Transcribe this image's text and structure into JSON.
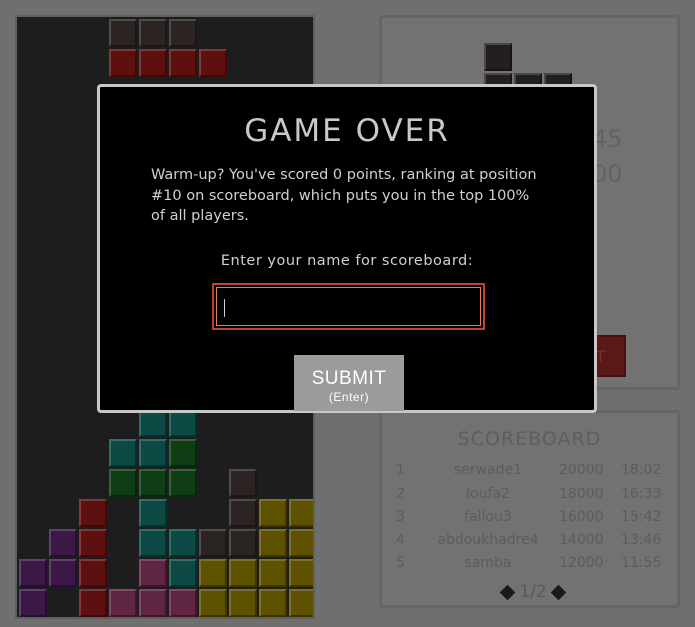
{
  "board": {
    "colors": {
      "dark": "#2c2323",
      "red": "#5e1010",
      "teal": "#0d4a45",
      "green": "#0f3d14",
      "purple": "#3c1848",
      "pink": "#602542",
      "yellow": "#5e5200"
    },
    "cells": [
      {
        "c": 3,
        "r": 0,
        "k": "dark"
      },
      {
        "c": 4,
        "r": 0,
        "k": "dark"
      },
      {
        "c": 5,
        "r": 0,
        "k": "dark"
      },
      {
        "c": 3,
        "r": 1,
        "k": "red"
      },
      {
        "c": 4,
        "r": 1,
        "k": "red"
      },
      {
        "c": 5,
        "r": 1,
        "k": "red"
      },
      {
        "c": 6,
        "r": 1,
        "k": "red"
      },
      {
        "c": 4,
        "r": 13,
        "k": "teal"
      },
      {
        "c": 5,
        "r": 13,
        "k": "teal"
      },
      {
        "c": 3,
        "r": 14,
        "k": "teal"
      },
      {
        "c": 4,
        "r": 14,
        "k": "teal"
      },
      {
        "c": 5,
        "r": 14,
        "k": "green"
      },
      {
        "c": 3,
        "r": 15,
        "k": "green"
      },
      {
        "c": 4,
        "r": 15,
        "k": "green"
      },
      {
        "c": 5,
        "r": 15,
        "k": "green"
      },
      {
        "c": 7,
        "r": 15,
        "k": "dark"
      },
      {
        "c": 2,
        "r": 16,
        "k": "red"
      },
      {
        "c": 4,
        "r": 16,
        "k": "teal"
      },
      {
        "c": 7,
        "r": 16,
        "k": "dark"
      },
      {
        "c": 8,
        "r": 16,
        "k": "yellow"
      },
      {
        "c": 9,
        "r": 16,
        "k": "yellow"
      },
      {
        "c": 1,
        "r": 17,
        "k": "purple"
      },
      {
        "c": 2,
        "r": 17,
        "k": "red"
      },
      {
        "c": 4,
        "r": 17,
        "k": "teal"
      },
      {
        "c": 5,
        "r": 17,
        "k": "teal"
      },
      {
        "c": 6,
        "r": 17,
        "k": "dark"
      },
      {
        "c": 7,
        "r": 17,
        "k": "dark"
      },
      {
        "c": 8,
        "r": 17,
        "k": "yellow"
      },
      {
        "c": 9,
        "r": 17,
        "k": "yellow"
      },
      {
        "c": 0,
        "r": 18,
        "k": "purple"
      },
      {
        "c": 1,
        "r": 18,
        "k": "purple"
      },
      {
        "c": 2,
        "r": 18,
        "k": "red"
      },
      {
        "c": 4,
        "r": 18,
        "k": "pink"
      },
      {
        "c": 5,
        "r": 18,
        "k": "teal"
      },
      {
        "c": 6,
        "r": 18,
        "k": "yellow"
      },
      {
        "c": 7,
        "r": 18,
        "k": "yellow"
      },
      {
        "c": 8,
        "r": 18,
        "k": "yellow"
      },
      {
        "c": 9,
        "r": 18,
        "k": "yellow"
      },
      {
        "c": 0,
        "r": 19,
        "k": "purple"
      },
      {
        "c": 2,
        "r": 19,
        "k": "red"
      },
      {
        "c": 3,
        "r": 19,
        "k": "pink"
      },
      {
        "c": 4,
        "r": 19,
        "k": "pink"
      },
      {
        "c": 5,
        "r": 19,
        "k": "pink"
      },
      {
        "c": 6,
        "r": 19,
        "k": "yellow"
      },
      {
        "c": 7,
        "r": 19,
        "k": "yellow"
      },
      {
        "c": 8,
        "r": 19,
        "k": "yellow"
      },
      {
        "c": 9,
        "r": 19,
        "k": "yellow"
      }
    ]
  },
  "next_piece": {
    "color": "#241e1e",
    "cells": [
      {
        "c": 0,
        "r": 0
      },
      {
        "c": 0,
        "r": 1
      },
      {
        "c": 1,
        "r": 1
      },
      {
        "c": 2,
        "r": 1
      }
    ]
  },
  "stats": {
    "lines_value": "45",
    "score_value": "00"
  },
  "restart_label": "RT",
  "scoreboard": {
    "title": "SCOREBOARD",
    "rows": [
      {
        "rank": "1",
        "name": "serwade1",
        "score": "20000",
        "time": "18:02"
      },
      {
        "rank": "2",
        "name": "loufa2",
        "score": "18000",
        "time": "16:33"
      },
      {
        "rank": "3",
        "name": "fallou3",
        "score": "16000",
        "time": "15:42"
      },
      {
        "rank": "4",
        "name": "abdoukhadre4",
        "score": "14000",
        "time": "13:46"
      },
      {
        "rank": "5",
        "name": "samba",
        "score": "12000",
        "time": "11:55"
      }
    ],
    "page_label": "1/2"
  },
  "modal": {
    "title": "GAME OVER",
    "message": "Warm-up? You've scored 0 points, ranking at position #10 on scoreboard, which puts you in the top 100% of all players.",
    "prompt": "Enter your name for scoreboard:",
    "input_value": "",
    "submit_label": "SUBMIT",
    "submit_hint": "(Enter)"
  }
}
